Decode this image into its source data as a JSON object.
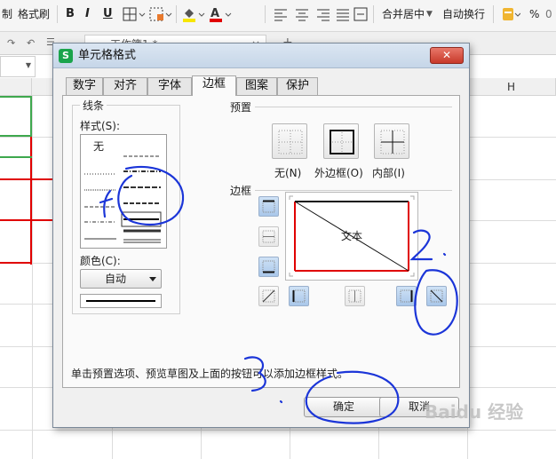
{
  "toolbar": {
    "cut_label": "制",
    "format_painter_label": "格式刷",
    "bold": "B",
    "italic": "I",
    "underline": "U",
    "merge_center": "合并居中",
    "wrap_text": "自动换行",
    "percent": "%"
  },
  "doc_tab": {
    "label": "工作簿1 *"
  },
  "grid": {
    "column_h": "H"
  },
  "dialog": {
    "title": "单元格格式",
    "close_label": "✕",
    "tabs": [
      {
        "label": "数字"
      },
      {
        "label": "对齐"
      },
      {
        "label": "字体"
      },
      {
        "label": "边框"
      },
      {
        "label": "图案"
      },
      {
        "label": "保护"
      }
    ],
    "active_tab": "边框",
    "line": {
      "group_title": "线条",
      "style_label": "样式(S):",
      "none_label": "无",
      "color_label": "颜色(C):",
      "color_value": "自动"
    },
    "preset": {
      "title": "预置",
      "none": "无(N)",
      "outline": "外边框(O)",
      "inside": "内部(I)"
    },
    "border": {
      "title": "边框",
      "preview_text": "文本",
      "accent_color": "#e00000"
    },
    "hint": "单击预置选项、预览草图及上面的按钮可以添加边框样式。",
    "ok_label": "确定",
    "cancel_label": "取消"
  },
  "annotations": {
    "mark_1": "1",
    "mark_2": "2.",
    "mark_3": "3."
  },
  "watermark": "Baidu 经验"
}
